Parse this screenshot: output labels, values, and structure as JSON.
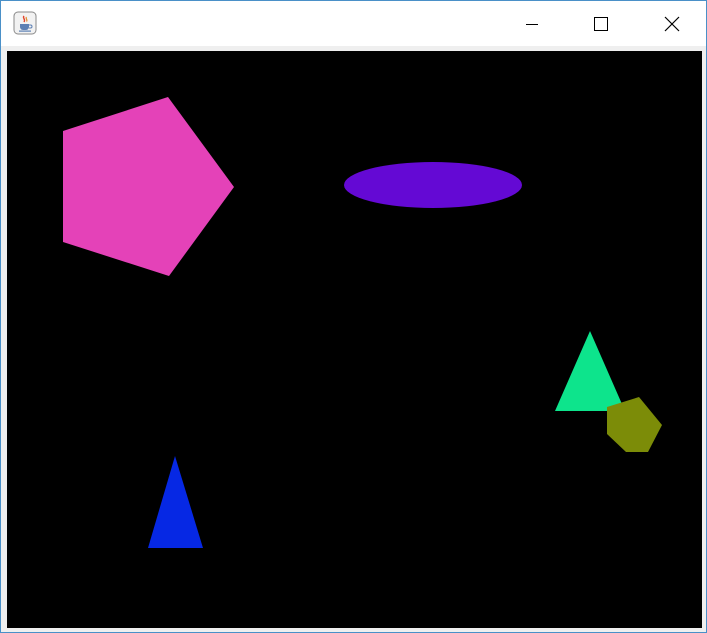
{
  "window": {
    "title": "",
    "icon": "java-coffee-cup-icon",
    "controls": {
      "minimize_icon": "minimize-icon",
      "maximize_icon": "maximize-icon",
      "close_icon": "close-icon"
    }
  },
  "canvas": {
    "background": "#000000",
    "shapes": [
      {
        "name": "pentagon-magenta",
        "kind": "pentagon",
        "color": "#e442b8"
      },
      {
        "name": "ellipse-purple",
        "kind": "ellipse",
        "color": "#6409d4"
      },
      {
        "name": "triangle-green",
        "kind": "triangle",
        "color": "#0de48c"
      },
      {
        "name": "pentagon-olive",
        "kind": "pentagon",
        "color": "#7c8c08"
      },
      {
        "name": "triangle-blue",
        "kind": "triangle",
        "color": "#0628e4"
      }
    ]
  }
}
